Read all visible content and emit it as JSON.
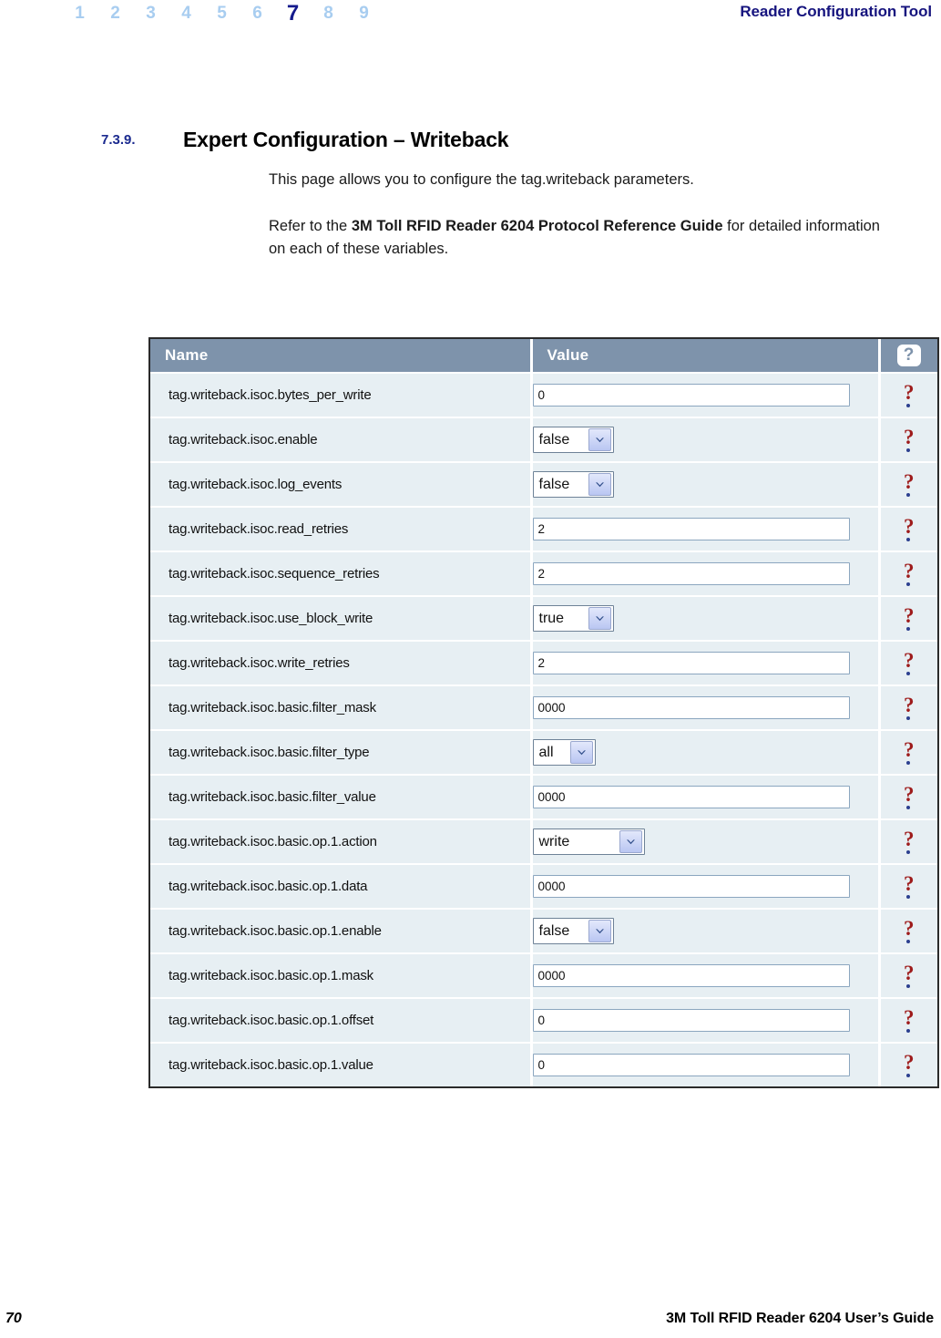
{
  "header": {
    "page_numbers": [
      "1",
      "2",
      "3",
      "4",
      "5",
      "6",
      "7",
      "8",
      "9"
    ],
    "current_page_number": "7",
    "tool_title": "Reader Configuration Tool",
    "accent_color": "#16147e",
    "inactive_number_color": "#a8cdf0"
  },
  "section": {
    "number": "7.3.9.",
    "title": "Expert Configuration – Writeback",
    "paragraph_1": "This page allows you to configure the tag.writeback parameters.",
    "paragraph_2_prefix": "Refer to the ",
    "paragraph_2_bold": "3M Toll RFID Reader 6204 Protocol Reference Guide",
    "paragraph_2_suffix": " for detailed information on each of these variables."
  },
  "config_table": {
    "header_color": "#7e93ab",
    "row_color": "#e7eff3",
    "columns": {
      "name": "Name",
      "value": "Value",
      "help": "?"
    },
    "help_icon_name": "question-mark-help-icon",
    "rows": [
      {
        "name": "tag.writeback.isoc.bytes_per_write",
        "control": "text",
        "value": "0",
        "help": "?"
      },
      {
        "name": "tag.writeback.isoc.enable",
        "control": "select",
        "value": "false",
        "help": "?"
      },
      {
        "name": "tag.writeback.isoc.log_events",
        "control": "select",
        "value": "false",
        "help": "?"
      },
      {
        "name": "tag.writeback.isoc.read_retries",
        "control": "text",
        "value": "2",
        "help": "?"
      },
      {
        "name": "tag.writeback.isoc.sequence_retries",
        "control": "text",
        "value": "2",
        "help": "?"
      },
      {
        "name": "tag.writeback.isoc.use_block_write",
        "control": "select",
        "value": "true",
        "help": "?"
      },
      {
        "name": "tag.writeback.isoc.write_retries",
        "control": "text",
        "value": "2",
        "help": "?"
      },
      {
        "name": "tag.writeback.isoc.basic.filter_mask",
        "control": "text",
        "value": "0000",
        "help": "?"
      },
      {
        "name": "tag.writeback.isoc.basic.filter_type",
        "control": "select",
        "value": "all",
        "help": "?"
      },
      {
        "name": "tag.writeback.isoc.basic.filter_value",
        "control": "text",
        "value": "0000",
        "help": "?"
      },
      {
        "name": "tag.writeback.isoc.basic.op.1.action",
        "control": "select",
        "value": "write",
        "help": "?"
      },
      {
        "name": "tag.writeback.isoc.basic.op.1.data",
        "control": "text",
        "value": "0000",
        "help": "?"
      },
      {
        "name": "tag.writeback.isoc.basic.op.1.enable",
        "control": "select",
        "value": "false",
        "help": "?"
      },
      {
        "name": "tag.writeback.isoc.basic.op.1.mask",
        "control": "text",
        "value": "0000",
        "help": "?"
      },
      {
        "name": "tag.writeback.isoc.basic.op.1.offset",
        "control": "text",
        "value": "0",
        "help": "?"
      },
      {
        "name": "tag.writeback.isoc.basic.op.1.value",
        "control": "text",
        "value": "0",
        "help": "?"
      }
    ]
  },
  "footer": {
    "page_number": "70",
    "guide_title": "3M Toll RFID Reader 6204 User’s Guide"
  }
}
